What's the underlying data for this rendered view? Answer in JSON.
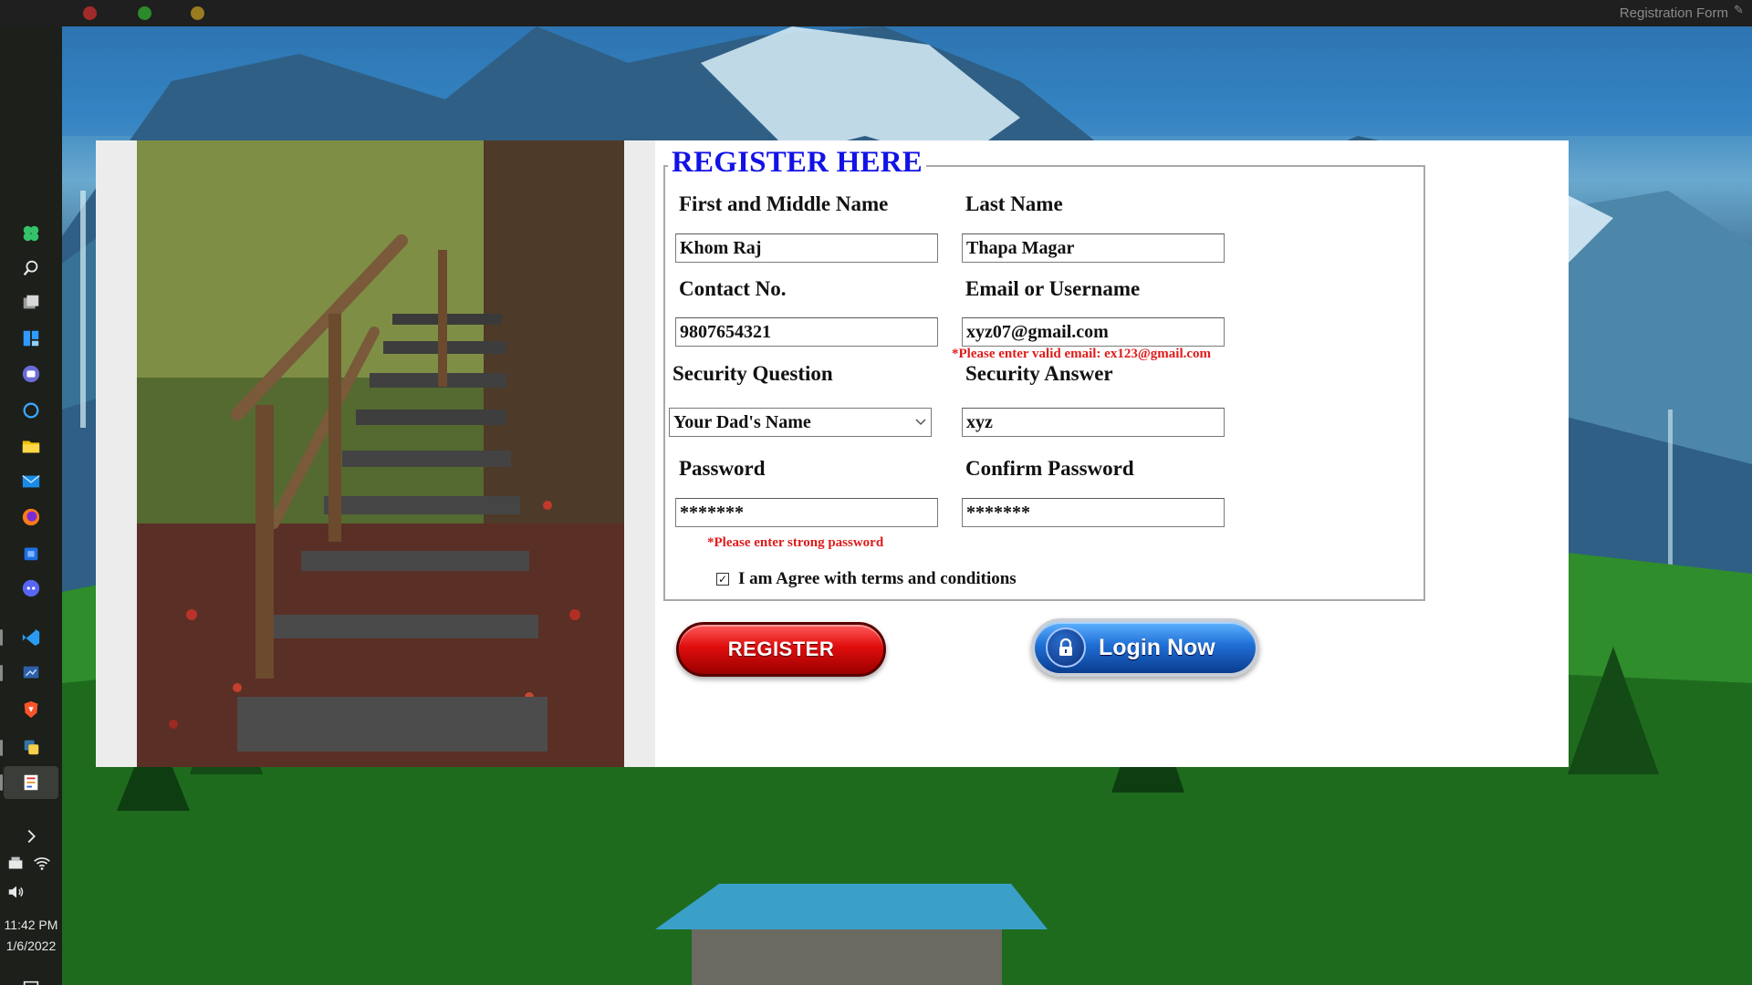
{
  "window": {
    "title": "Registration Form"
  },
  "taskbar": {
    "icons": [
      "app-launcher-icon",
      "search-icon",
      "task-view-icon",
      "widgets-icon",
      "teams-icon",
      "cortana-icon",
      "file-explorer-icon",
      "mail-icon",
      "firefox-icon",
      "store-icon",
      "discord-icon",
      "vscode-icon",
      "remote-desktop-icon",
      "brave-icon",
      "python-icon",
      "registration-app-icon"
    ],
    "time": "11:42 PM",
    "date": "1/6/2022"
  },
  "form": {
    "heading": "REGISTER HERE",
    "first_name_label": "First and Middle Name",
    "first_name_value": "Khom Raj",
    "last_name_label": "Last Name",
    "last_name_value": "Thapa Magar",
    "contact_label": "Contact No.",
    "contact_value": "9807654321",
    "email_label": "Email or Username",
    "email_value": "xyz07@gmail.com",
    "email_error": "*Please enter valid email: ex123@gmail.com",
    "security_question_label": "Security Question",
    "security_question_value": "Your Dad's Name",
    "security_answer_label": "Security Answer",
    "security_answer_value": "xyz",
    "password_label": "Password",
    "password_value": "*******",
    "confirm_password_label": "Confirm Password",
    "confirm_password_value": "*******",
    "password_error": "*Please enter strong password",
    "terms_checked": true,
    "terms_label": "I am Agree with terms and conditions",
    "register_button": "REGISTER",
    "login_button": "Login Now"
  },
  "colors": {
    "heading": "#1212e6",
    "error": "#e01b1b",
    "register_button": "#e00d0d",
    "login_button": "#1f6fd6"
  }
}
